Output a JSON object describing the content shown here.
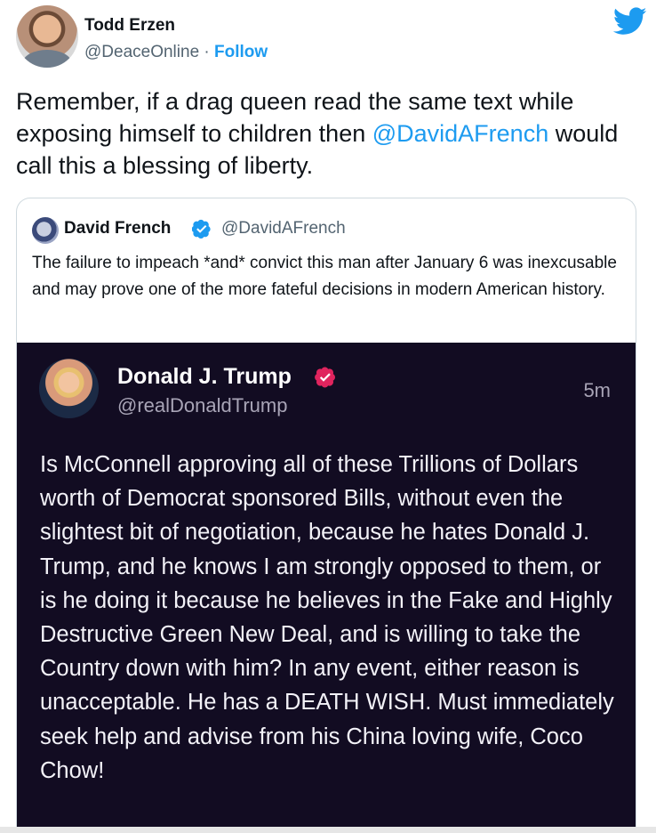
{
  "tweet": {
    "author_name": "Todd Erzen",
    "author_handle": "@DeaceOnline",
    "separator": " · ",
    "follow_label": "Follow",
    "text_before": "Remember, if a drag queen read the same text while exposing himself to children then ",
    "mention": "@DavidAFrench",
    "text_after": " would call this a blessing of liberty."
  },
  "quote": {
    "author_name": "David French",
    "author_handle": "@DavidAFrench",
    "text": "The failure to impeach *and* convict this man after January 6 was inexcusable and may prove one of the more fateful decisions in modern American history."
  },
  "media_post": {
    "author_name": "Donald J. Trump",
    "author_handle": "@realDonaldTrump",
    "time": "5m",
    "text": "Is McConnell approving all of these Trillions of Dollars worth of Democrat sponsored Bills, without even the slightest bit of negotiation, because he hates Donald J. Trump, and he knows I am strongly opposed to them, or is he doing it because he believes in the Fake and Highly Destructive Green New Deal, and is willing to take the Country down with him? In any event, either reason is unacceptable. He has a DEATH WISH. Must immediately seek help and advise from his China loving wife, Coco Chow!"
  },
  "icons": {
    "twitter": "twitter-bird-icon",
    "verified_blue": "verified-badge-icon",
    "verified_red": "verified-badge-icon"
  },
  "colors": {
    "link": "#1d9bf0",
    "media_bg": "#120c22",
    "verified_red": "#e0245e"
  }
}
